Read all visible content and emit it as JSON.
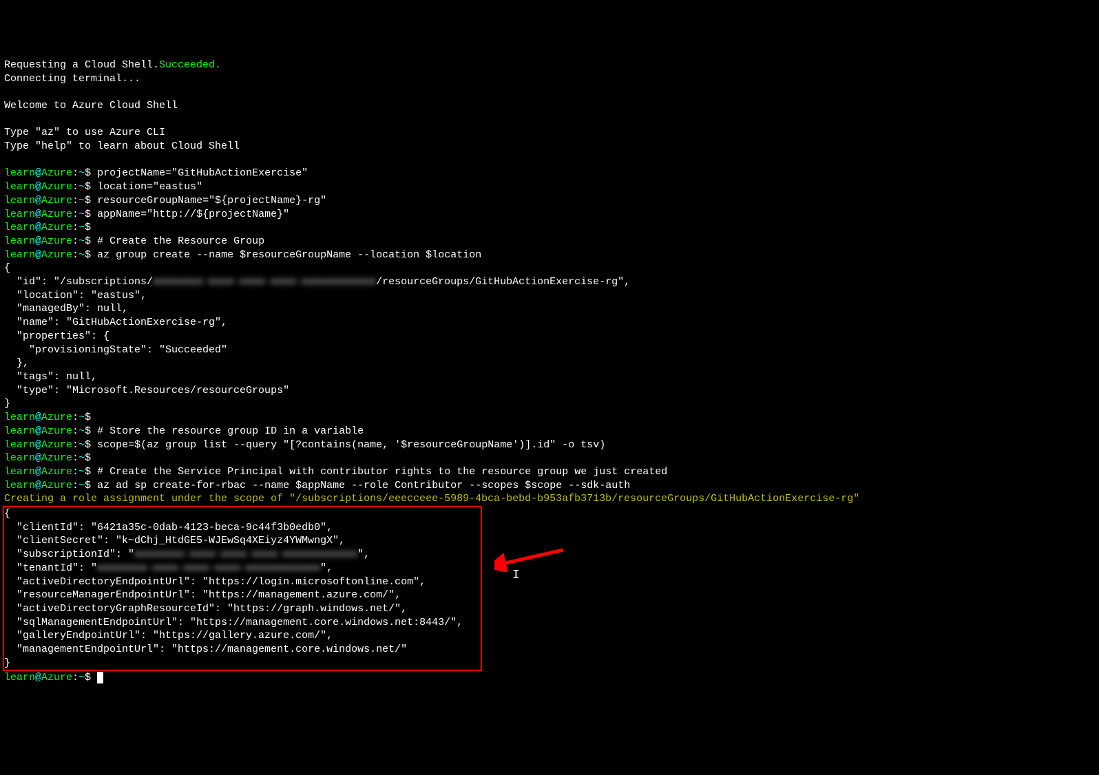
{
  "intro": {
    "request": "Requesting a Cloud Shell.",
    "succeeded": "Succeeded.",
    "connecting": "Connecting terminal...",
    "welcome": "Welcome to Azure Cloud Shell",
    "typeaz": "Type \"az\" to use Azure CLI",
    "typehelp": "Type \"help\" to learn about Cloud Shell"
  },
  "prompt": {
    "user": "learn",
    "at": "@",
    "host": "Azure",
    "sep": ":",
    "path": "~",
    "sym": "$"
  },
  "cmds": {
    "c1": "projectName=\"GitHubActionExercise\"",
    "c2": "location=\"eastus\"",
    "c3": "resourceGroupName=\"${projectName}-rg\"",
    "c4": "appName=\"http://${projectName}\"",
    "c5": "",
    "c6": "# Create the Resource Group",
    "c7": "az group create --name $resourceGroupName --location $location",
    "c8": "",
    "c9": "# Store the resource group ID in a variable",
    "c10": "scope=$(az group list --query \"[?contains(name, '$resourceGroupName')].id\" -o tsv)",
    "c11": "",
    "c12": "# Create the Service Principal with contributor rights to the resource group we just created",
    "c13": "az ad sp create-for-rbac --name $appName --role Contributor --scopes $scope --sdk-auth"
  },
  "json1": {
    "open": "{",
    "id_pre": "  \"id\": \"/subscriptions/",
    "id_post": "/resourceGroups/GitHubActionExercise-rg\",",
    "location": "  \"location\": \"eastus\",",
    "managedBy": "  \"managedBy\": null,",
    "name": "  \"name\": \"GitHubActionExercise-rg\",",
    "properties": "  \"properties\": {",
    "prov": "    \"provisioningState\": \"Succeeded\"",
    "propclose": "  },",
    "tags": "  \"tags\": null,",
    "type": "  \"type\": \"Microsoft.Resources/resourceGroups\"",
    "close": "}"
  },
  "role_msg": "Creating a role assignment under the scope of \"/subscriptions/eeecceee-5989-4bca-bebd-b953afb3713b/resourceGroups/GitHubActionExercise-rg\"",
  "json2": {
    "open": "{",
    "clientId": "  \"clientId\": \"6421a35c-0dab-4123-beca-9c44f3b0edb0\",",
    "clientSecret": "  \"clientSecret\": \"k~dChj_HtdGE5-WJEwSq4XEiyz4YWMwngX\",",
    "subId_pre": "  \"subscriptionId\": \"",
    "subId_post": "\",",
    "tenant_pre": "  \"tenantId\": \"",
    "tenant_post": "\",",
    "ad_url": "  \"activeDirectoryEndpointUrl\": \"https://login.microsoftonline.com\",",
    "rm_url": "  \"resourceManagerEndpointUrl\": \"https://management.azure.com/\",",
    "adg_url": "  \"activeDirectoryGraphResourceId\": \"https://graph.windows.net/\",",
    "sql_url": "  \"sqlManagementEndpointUrl\": \"https://management.core.windows.net:8443/\",",
    "gal_url": "  \"galleryEndpointUrl\": \"https://gallery.azure.com/\",",
    "mgmt_url": "  \"managementEndpointUrl\": \"https://management.core.windows.net/\"",
    "close": "}"
  },
  "blurred": "xxxxxxxx-xxxx-xxxx-xxxx-xxxxxxxxxxxx"
}
